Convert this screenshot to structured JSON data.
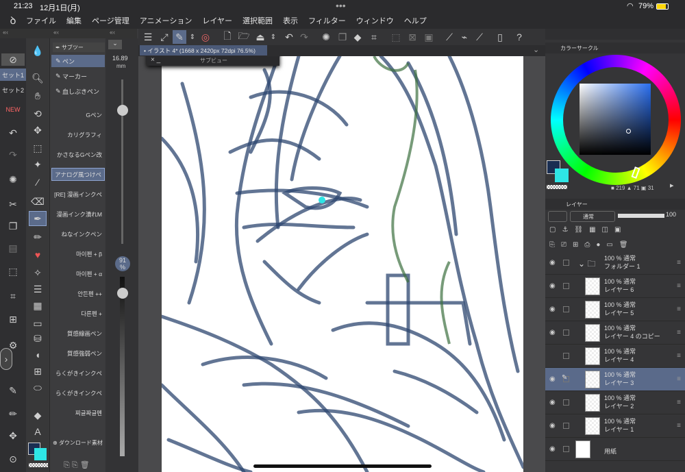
{
  "status": {
    "time": "21:23",
    "date": "12月1日(月)",
    "battery": "79%"
  },
  "menu": {
    "items": [
      "ファイル",
      "編集",
      "ページ管理",
      "アニメーション",
      "レイヤー",
      "選択範囲",
      "表示",
      "フィルター",
      "ウィンドウ",
      "ヘルプ"
    ]
  },
  "subtool": {
    "header": "サブツー",
    "items": [
      "ペン",
      "マーカー",
      "血しぶきペン"
    ]
  },
  "brushes": [
    "Gペン",
    "カリグラフィ",
    "かさなるGペン改",
    "アナログ風つけペ",
    "[RE] 漫画インクペ",
    "漫画インク潰れM",
    "ねなインクペン",
    "마이펜 + β",
    "마이펜 + α",
    "안든펜 ++",
    "다른펜 +",
    "質感線画ペン",
    "質感強弱ペン",
    "らくがきインクペ",
    "らくがきインクペ",
    "찌글짜글펜"
  ],
  "download_label": "ダウンロード素材",
  "size": {
    "value": "16.89",
    "unit": "mm",
    "opacity": "91",
    "opacity_unit": "%"
  },
  "sets": [
    "セット1",
    "セット2"
  ],
  "document": {
    "tab": "イラスト 4* (1668 x 2420px 72dpi 76.5%)",
    "subview": "サブビュー"
  },
  "color": {
    "title": "カラーサークル",
    "readout_h": "219",
    "readout_s": "71",
    "readout_v": "31",
    "fg": "#1a2e52",
    "bg": "#2ee6e6"
  },
  "layer_panel": {
    "title": "レイヤー",
    "blend": "通常",
    "opacity": "100"
  },
  "layers": [
    {
      "opacity": "100 %",
      "mode": "通常",
      "name": "フォルダー 1",
      "type": "folder",
      "visible": true,
      "selected": false
    },
    {
      "opacity": "100 %",
      "mode": "通常",
      "name": "レイヤー 6",
      "type": "layer",
      "visible": true,
      "selected": false
    },
    {
      "opacity": "100 %",
      "mode": "通常",
      "name": "レイヤー 5",
      "type": "layer",
      "visible": true,
      "selected": false
    },
    {
      "opacity": "100 %",
      "mode": "通常",
      "name": "レイヤー 4 のコピー",
      "type": "layer",
      "visible": true,
      "selected": false
    },
    {
      "opacity": "100 %",
      "mode": "通常",
      "name": "レイヤー 4",
      "type": "layer",
      "visible": false,
      "selected": false
    },
    {
      "opacity": "100 %",
      "mode": "通常",
      "name": "レイヤー 3",
      "type": "layer",
      "visible": true,
      "selected": true
    },
    {
      "opacity": "100 %",
      "mode": "通常",
      "name": "レイヤー 2",
      "type": "layer",
      "visible": true,
      "selected": false
    },
    {
      "opacity": "100 %",
      "mode": "通常",
      "name": "レイヤー 1",
      "type": "layer",
      "visible": true,
      "selected": false
    },
    {
      "opacity": "",
      "mode": "",
      "name": "用紙",
      "type": "paper",
      "visible": true,
      "selected": false
    }
  ]
}
